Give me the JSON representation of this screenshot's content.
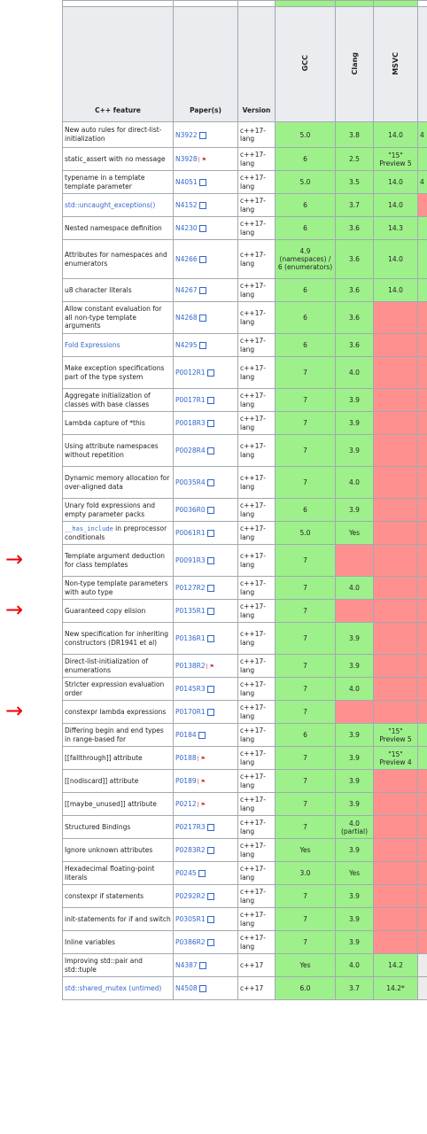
{
  "headers": {
    "feature": "C++ feature",
    "papers": "Paper(s)",
    "version": "Version",
    "gcc": "GCC",
    "clang": "Clang",
    "msvc": "MSVC"
  },
  "colors": {
    "supported": "#9ef08a",
    "unsupported": "#ff9090",
    "header": "#eaecf0",
    "link": "#3366cc",
    "annotation": "#e00000"
  },
  "rows": [
    {
      "feature": "New auto rules for direct-list-initialization",
      "paper": "N3922",
      "paper_icon": "external-link-icon",
      "version": "c++17-lang",
      "gcc": "5.0",
      "clang": "3.8",
      "msvc": "14.0",
      "extra": "4"
    },
    {
      "feature": "static_assert with no message",
      "paper": "N3928",
      "paper_icon": "pdf-icon",
      "version": "c++17-lang",
      "gcc": "6",
      "clang": "2.5",
      "msvc": "\"15\" Preview 5"
    },
    {
      "feature": "typename in a template template parameter",
      "paper": "N4051",
      "paper_icon": "external-link-icon",
      "version": "c++17-lang",
      "gcc": "5.0",
      "clang": "3.5",
      "msvc": "14.0",
      "extra": "4"
    },
    {
      "feature": "std::uncaught_exceptions()",
      "feature_link": true,
      "paper": "N4152",
      "paper_icon": "external-link-icon",
      "version": "c++17-lang",
      "gcc": "6",
      "clang": "3.7",
      "msvc": "14.0",
      "extra_red": true
    },
    {
      "feature": "Nested namespace definition",
      "paper": "N4230",
      "paper_icon": "external-link-icon",
      "version": "c++17-lang",
      "gcc": "6",
      "clang": "3.6",
      "msvc": "14.3"
    },
    {
      "feature": "Attributes for namespaces and enumerators",
      "paper": "N4266",
      "paper_icon": "external-link-icon",
      "version": "c++17-lang",
      "gcc": "4.9 (namespaces) / 6 (enumerators)",
      "clang": "3.6",
      "msvc": "14.0"
    },
    {
      "feature": "u8 character literals",
      "paper": "N4267",
      "paper_icon": "external-link-icon",
      "version": "c++17-lang",
      "gcc": "6",
      "clang": "3.6",
      "msvc": "14.0"
    },
    {
      "feature": "Allow constant evaluation for all non-type template arguments",
      "paper": "N4268",
      "paper_icon": "external-link-icon",
      "version": "c++17-lang",
      "gcc": "6",
      "clang": "3.6",
      "msvc": ""
    },
    {
      "feature": "Fold Expressions",
      "feature_link": true,
      "paper": "N4295",
      "paper_icon": "external-link-icon",
      "version": "c++17-lang",
      "gcc": "6",
      "clang": "3.6",
      "msvc": ""
    },
    {
      "feature": "Make exception specifications part of the type system",
      "paper": "P0012R1",
      "paper_icon": "external-link-icon",
      "version": "c++17-lang",
      "gcc": "7",
      "clang": "4.0",
      "msvc": ""
    },
    {
      "feature": "Aggregate initialization of classes with base classes",
      "paper": "P0017R1",
      "paper_icon": "external-link-icon",
      "version": "c++17-lang",
      "gcc": "7",
      "clang": "3.9",
      "msvc": ""
    },
    {
      "feature": "Lambda capture of *this",
      "paper": "P0018R3",
      "paper_icon": "external-link-icon",
      "version": "c++17-lang",
      "gcc": "7",
      "clang": "3.9",
      "msvc": ""
    },
    {
      "feature": "Using attribute namespaces without repetition",
      "paper": "P0028R4",
      "paper_icon": "external-link-icon",
      "version": "c++17-lang",
      "gcc": "7",
      "clang": "3.9",
      "msvc": ""
    },
    {
      "feature": "Dynamic memory allocation for over-aligned data",
      "paper": "P0035R4",
      "paper_icon": "external-link-icon",
      "version": "c++17-lang",
      "gcc": "7",
      "clang": "4.0",
      "msvc": ""
    },
    {
      "feature": "Unary fold expressions and empty parameter packs",
      "paper": "P0036R0",
      "paper_icon": "external-link-icon",
      "version": "c++17-lang",
      "gcc": "6",
      "clang": "3.9",
      "msvc": ""
    },
    {
      "feature_code": "__has_include",
      "feature": "in preprocessor conditionals",
      "paper": "P0061R1",
      "paper_icon": "external-link-icon",
      "version": "c++17-lang",
      "gcc": "5.0",
      "clang": "Yes",
      "msvc": ""
    },
    {
      "feature": "Template argument deduction for class templates",
      "paper": "P0091R3",
      "paper_icon": "external-link-icon",
      "version": "c++17-lang",
      "gcc": "7",
      "clang": "",
      "msvc": "",
      "arrow": true
    },
    {
      "feature": "Non-type template parameters with auto type",
      "paper": "P0127R2",
      "paper_icon": "external-link-icon",
      "version": "c++17-lang",
      "gcc": "7",
      "clang": "4.0",
      "msvc": ""
    },
    {
      "feature": "Guaranteed copy elision",
      "paper": "P0135R1",
      "paper_icon": "external-link-icon",
      "version": "c++17-lang",
      "gcc": "7",
      "clang": "",
      "msvc": "",
      "arrow": true
    },
    {
      "feature": "New specification for inheriting constructors (DR1941 et al)",
      "paper": "P0136R1",
      "paper_icon": "external-link-icon",
      "version": "c++17-lang",
      "gcc": "7",
      "clang": "3.9",
      "msvc": ""
    },
    {
      "feature": "Direct-list-initialization of enumerations",
      "paper": "P0138R2",
      "paper_icon": "pdf-icon",
      "version": "c++17-lang",
      "gcc": "7",
      "clang": "3.9",
      "msvc": ""
    },
    {
      "feature": "Stricter expression evaluation order",
      "paper": "P0145R3",
      "paper_icon": "external-link-icon",
      "version": "c++17-lang",
      "gcc": "7",
      "clang": "4.0",
      "msvc": ""
    },
    {
      "feature": "constexpr lambda expressions",
      "paper": "P0170R1",
      "paper_icon": "external-link-icon",
      "version": "c++17-lang",
      "gcc": "7",
      "clang": "",
      "msvc": "",
      "arrow": true
    },
    {
      "feature": "Differing begin and end types in range-based for",
      "paper": "P0184",
      "paper_icon": "external-link-icon",
      "version": "c++17-lang",
      "gcc": "6",
      "clang": "3.9",
      "msvc": "\"15\" Preview 5"
    },
    {
      "feature": "[[fallthrough]] attribute",
      "paper": "P0188",
      "paper_icon": "pdf-icon",
      "version": "c++17-lang",
      "gcc": "7",
      "clang": "3.9",
      "msvc": "\"15\" Preview 4"
    },
    {
      "feature": "[[nodiscard]] attribute",
      "paper": "P0189",
      "paper_icon": "pdf-icon",
      "version": "c++17-lang",
      "gcc": "7",
      "clang": "3.9",
      "msvc": ""
    },
    {
      "feature": "[[maybe_unused]] attribute",
      "paper": "P0212",
      "paper_icon": "pdf-icon",
      "version": "c++17-lang",
      "gcc": "7",
      "clang": "3.9",
      "msvc": ""
    },
    {
      "feature": "Structured Bindings",
      "paper": "P0217R3",
      "paper_icon": "external-link-icon",
      "version": "c++17-lang",
      "gcc": "7",
      "clang": "4.0 (partial)",
      "msvc": ""
    },
    {
      "feature": "Ignore unknown attributes",
      "paper": "P0283R2",
      "paper_icon": "external-link-icon",
      "version": "c++17-lang",
      "gcc": "Yes",
      "clang": "3.9",
      "msvc": ""
    },
    {
      "feature": "Hexadecimal floating-point literals",
      "paper": "P0245",
      "paper_icon": "external-link-icon",
      "version": "c++17-lang",
      "gcc": "3.0",
      "clang": "Yes",
      "msvc": ""
    },
    {
      "feature": "constexpr if statements",
      "feature_link_part": "constexpr",
      "paper": "P0292R2",
      "paper_icon": "external-link-icon",
      "version": "c++17-lang",
      "gcc": "7",
      "clang": "3.9",
      "msvc": ""
    },
    {
      "feature": "init-statements for if and switch",
      "paper": "P0305R1",
      "paper_icon": "external-link-icon",
      "version": "c++17-lang",
      "gcc": "7",
      "clang": "3.9",
      "msvc": ""
    },
    {
      "feature": "Inline variables",
      "paper": "P0386R2",
      "paper_icon": "external-link-icon",
      "version": "c++17-lang",
      "gcc": "7",
      "clang": "3.9",
      "msvc": ""
    },
    {
      "feature": "Improving std::pair and std::tuple",
      "paper": "N4387",
      "paper_icon": "external-link-icon",
      "version": "c++17",
      "gcc": "Yes",
      "clang": "4.0",
      "msvc": "14.2",
      "lib": true
    },
    {
      "feature": "std::shared_mutex (untimed)",
      "feature_link": true,
      "paper": "N4508",
      "paper_icon": "external-link-icon",
      "version": "c++17",
      "gcc": "6.0",
      "clang": "3.7",
      "msvc": "14.2*",
      "lib": true
    }
  ]
}
